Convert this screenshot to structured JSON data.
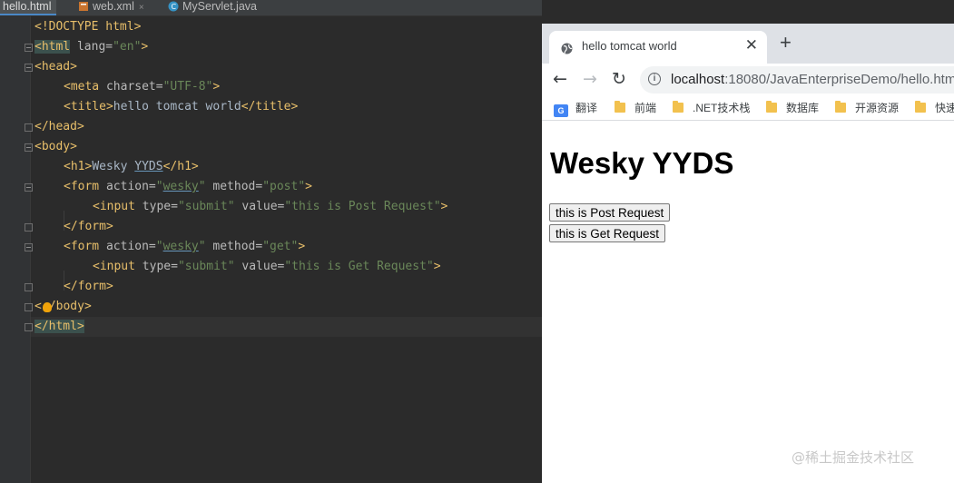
{
  "ide": {
    "tabs": [
      {
        "label": "hello.html",
        "active": true
      },
      {
        "label": "web.xml",
        "active": false
      },
      {
        "label": "MyServlet.java",
        "active": false
      }
    ],
    "close_glyph": "×",
    "code": {
      "l1": {
        "tag": "<!DOCTYPE html>"
      },
      "l2": {
        "o": "<html",
        "a": " lang=",
        "v": "\"en\"",
        "c": ">"
      },
      "l3": {
        "tag": "<head>"
      },
      "l4": {
        "o": "<meta",
        "a": " charset=",
        "v": "\"UTF-8\"",
        "c": ">"
      },
      "l5": {
        "o": "<title>",
        "t": "hello tomcat world",
        "c": "</title>"
      },
      "l6": {
        "tag": "</head>"
      },
      "l7": {
        "tag": "<body>"
      },
      "l8": {
        "o": "<h1>",
        "t1": "Wesky ",
        "t2": "YYDS",
        "c": "</h1>"
      },
      "l9": {
        "o": "<form",
        "a1": " action=",
        "v1q": "\"",
        "v1": "wesky",
        "v1e": "\"",
        "a2": " method=",
        "v2": "\"post\"",
        "c": ">"
      },
      "l10": {
        "o": "<input",
        "a1": " type=",
        "v1": "\"submit\"",
        "a2": " value=",
        "v2": "\"this is Post Request\"",
        "c": ">"
      },
      "l11": {
        "tag": "</form>"
      },
      "l12": {
        "o": "<form",
        "a1": " action=",
        "v1q": "\"",
        "v1": "wesky",
        "v1e": "\"",
        "a2": " method=",
        "v2": "\"get\"",
        "c": ">"
      },
      "l13": {
        "o": "<input",
        "a1": " type=",
        "v1": "\"submit\"",
        "a2": " value=",
        "v2": "\"this is Get Request\"",
        "c": ">"
      },
      "l14": {
        "tag": "</form>"
      },
      "l15": {
        "a": "<",
        "b": "/body>"
      },
      "l16": {
        "tag": "</html>"
      }
    },
    "colors": {
      "tag": "#e8bf6a",
      "attr": "#bababa",
      "value": "#6a8759",
      "text": "#a9b7c6",
      "background": "#2b2b2b"
    }
  },
  "browser": {
    "tab_title": "hello tomcat world",
    "tab_close": "✕",
    "new_tab": "+",
    "nav": {
      "back": "←",
      "forward": "→",
      "reload": "↻"
    },
    "info_icon": "i",
    "url_host": "localhost",
    "url_path": ":18080/JavaEnterpriseDemo/hello.htm",
    "bookmarks": [
      {
        "label": "翻译",
        "icon": "translate-icon"
      },
      {
        "label": "前端",
        "icon": "folder-icon"
      },
      {
        "label": ".NET技术栈",
        "icon": "folder-icon"
      },
      {
        "label": "数据库",
        "icon": "folder-icon"
      },
      {
        "label": "开源资源",
        "icon": "folder-icon"
      },
      {
        "label": "快速",
        "icon": "folder-icon"
      }
    ],
    "page": {
      "heading": "Wesky YYDS",
      "post_button": "this is Post Request",
      "get_button": "this is Get Request"
    }
  },
  "watermark": "@稀土掘金技术社区"
}
